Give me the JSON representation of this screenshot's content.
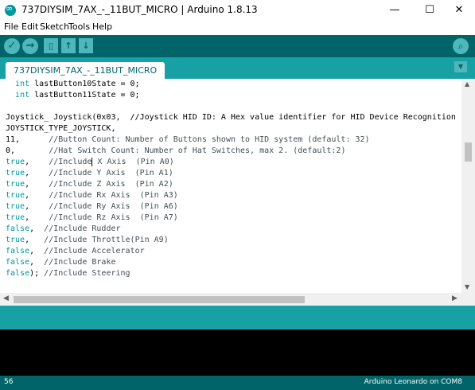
{
  "window": {
    "title": "737DIYSIM_7AX_-_11BUT_MICRO | Arduino 1.8.13",
    "minimize_glyph": "—",
    "maximize_glyph": "☐",
    "close_glyph": "✕"
  },
  "menu": [
    "File",
    "Edit",
    "Sketch",
    "Tools",
    "Help"
  ],
  "toolbar": {
    "verify_icon": "✓",
    "upload_icon": "→",
    "new_icon": "▯",
    "open_icon": "↑",
    "save_icon": "↓",
    "serial_icon": "⌕"
  },
  "tab": {
    "label": "737DIYSIM_7AX_-_11BUT_MICRO",
    "menu_glyph": "▼"
  },
  "code": [
    {
      "kw": "int",
      "text": " lastButton10State = 0;"
    },
    {
      "kw": "int",
      "text": " lastButton11State = 0;"
    },
    {
      "text": "Joystick_ Joystick(0x03,  //Joystick HID ID: A Hex value identifier for HID Device Recognition (defa"
    },
    {
      "text": "JOYSTICK_TYPE_JOYSTICK,"
    },
    {
      "text": "11,",
      "comment": "      //Button Count: Number of Buttons shown to HID system (default: 32)"
    },
    {
      "text": "0,",
      "comment": "       //Hat Switch Count: Number of Hat Switches, max 2. (default:2)"
    },
    {
      "kw": "true",
      "text": ",",
      "comment": "    //Include",
      "after": " X Axis  (Pin A0)"
    },
    {
      "kw": "true",
      "text": ",",
      "comment": "    //Include Y Axis  (Pin A1)"
    },
    {
      "kw": "true",
      "text": ",",
      "comment": "    //Include Z Axis  (Pin A2)"
    },
    {
      "kw": "true",
      "text": ",",
      "comment": "    //Include Rx Axis  (Pin A3)"
    },
    {
      "kw": "true",
      "text": ",",
      "comment": "    //Include Ry Axis  (Pin A6)"
    },
    {
      "kw": "true",
      "text": ",",
      "comment": "    //Include Rz Axis  (Pin A7)"
    },
    {
      "kw": "false",
      "text": ",",
      "comment": "  //Include Rudder"
    },
    {
      "kw": "true",
      "text": ",",
      "comment": "   //Include Throttle(Pin A9)"
    },
    {
      "kw": "false",
      "text": ",",
      "comment": "  //Include Accelerator"
    },
    {
      "kw": "false",
      "text": ",",
      "comment": "  //Include Brake"
    },
    {
      "kw": "false",
      "text": ");",
      "comment": " //Include Steering"
    }
  ],
  "status": {
    "line_number": "56",
    "board": "Arduino Leonardo on COM8"
  },
  "colors": {
    "toolbar": "#006468",
    "tabbar": "#17a1a5",
    "keyword": "#00979c",
    "console": "#000000"
  }
}
